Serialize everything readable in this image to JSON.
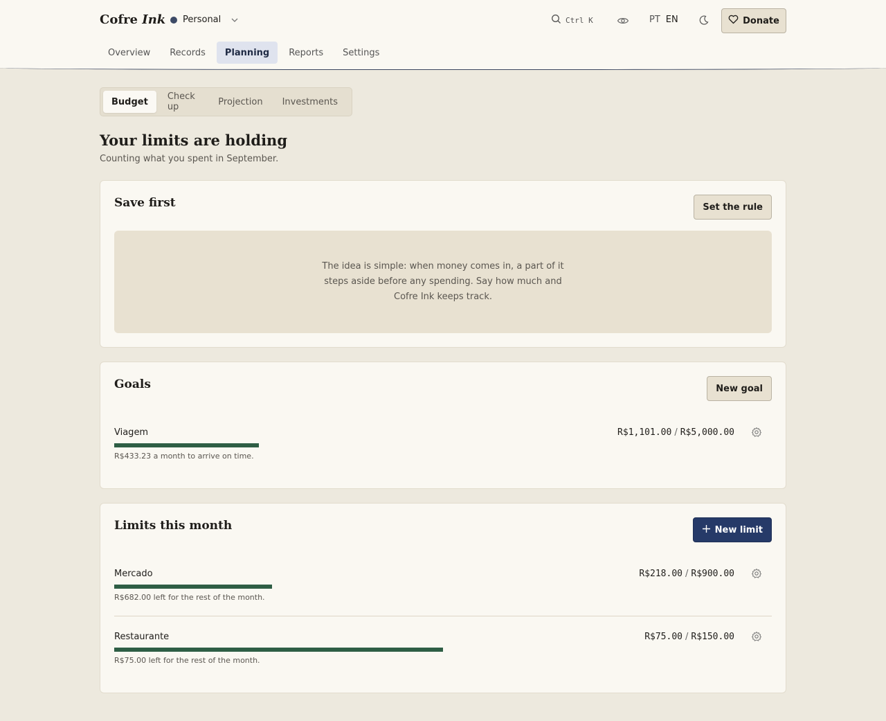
{
  "header": {
    "brand_main": "Cofre",
    "brand_italic": "Ink",
    "workspace": "Personal",
    "search_shortcut": "Ctrl K",
    "lang_pt": "PT",
    "lang_en": "EN",
    "donate_label": "Donate"
  },
  "nav": {
    "items": [
      {
        "label": "Overview"
      },
      {
        "label": "Records"
      },
      {
        "label": "Planning"
      },
      {
        "label": "Reports"
      },
      {
        "label": "Settings"
      }
    ]
  },
  "subtabs": {
    "items": [
      {
        "label": "Budget"
      },
      {
        "label": "Check up"
      },
      {
        "label": "Projection"
      },
      {
        "label": "Investments"
      }
    ]
  },
  "page": {
    "title": "Your limits are holding",
    "subtitle": "Counting what you spent in September."
  },
  "save_first": {
    "title": "Save first",
    "button": "Set the rule",
    "empty_text": "The idea is simple: when money comes in, a part of it steps aside before any spending. Say how much and Cofre Ink keeps track."
  },
  "goals": {
    "title": "Goals",
    "button": "New goal",
    "items": [
      {
        "name": "Viagem",
        "current": "R$1,101.00",
        "target": "R$5,000.00",
        "hint": "R$433.23 a month to arrive on time.",
        "progress": 0.22
      }
    ]
  },
  "limits": {
    "title": "Limits this month",
    "button": "New limit",
    "items": [
      {
        "name": "Mercado",
        "current": "R$218.00",
        "target": "R$900.00",
        "hint": "R$682.00 left for the rest of the month.",
        "progress": 0.24
      },
      {
        "name": "Restaurante",
        "current": "R$75.00",
        "target": "R$150.00",
        "hint": "R$75.00 left for the rest of the month.",
        "progress": 0.5
      }
    ]
  },
  "colors": {
    "accent": "#263a68",
    "progress": "#2e5e45",
    "background": "#ede9de",
    "card": "#faf8f2"
  },
  "icons": {
    "search": "search-icon",
    "visibility": "eye-icon",
    "theme": "moon-icon",
    "donate": "heart-icon",
    "row_settings": "gear-icon",
    "add": "plus-icon"
  }
}
